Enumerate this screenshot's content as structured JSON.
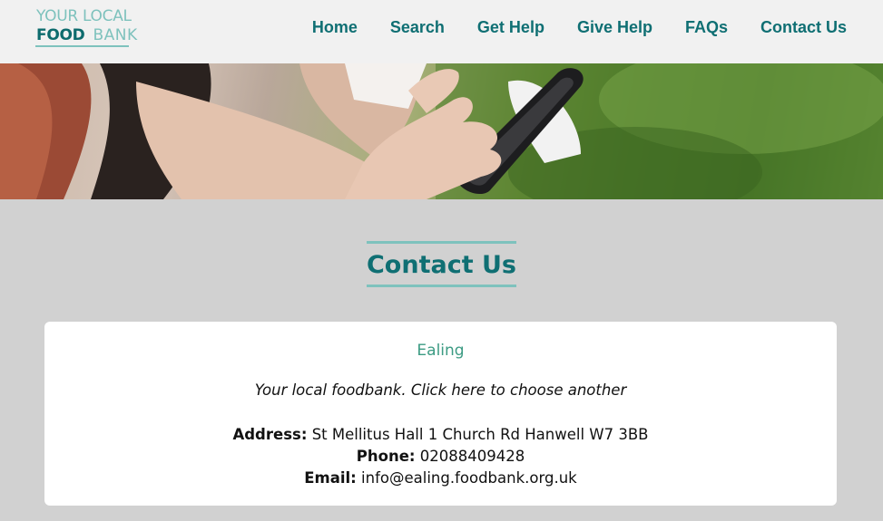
{
  "logo": {
    "line1": "YOUR LOCAL",
    "food": "FOOD",
    "bank": "BANK"
  },
  "nav": {
    "items": [
      {
        "label": "Home"
      },
      {
        "label": "Search"
      },
      {
        "label": "Get Help"
      },
      {
        "label": "Give Help"
      },
      {
        "label": "FAQs"
      },
      {
        "label": "Contact Us"
      }
    ]
  },
  "main": {
    "title": "Contact Us",
    "foodbank": {
      "name": "Ealing",
      "choose_text": "Your local foodbank. Click here to choose another",
      "address_label": "Address:",
      "address": "St Mellitus Hall 1 Church Rd Hanwell W7 3BB",
      "phone_label": "Phone:",
      "phone": "02088409428",
      "email_label": "Email:",
      "email": "info@ealing.foodbank.org.uk"
    }
  },
  "colors": {
    "brand_dark": "#0f6f73",
    "brand_light": "#7ec2bd",
    "page_bg": "#d1d1d1",
    "header_bg": "#f1f1f1"
  }
}
